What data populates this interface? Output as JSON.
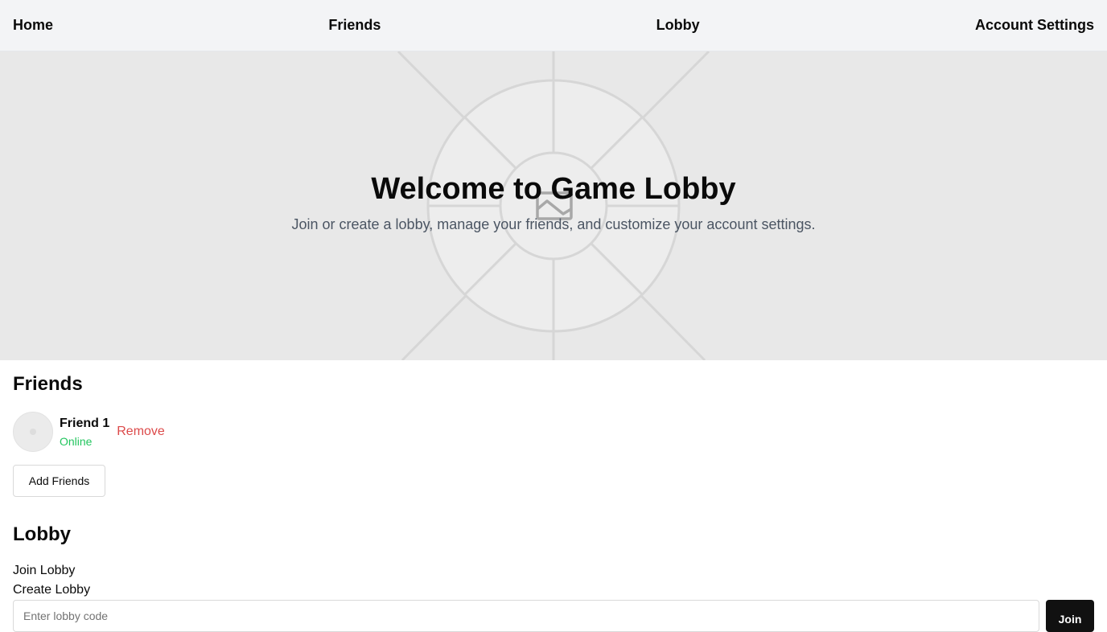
{
  "nav": {
    "home": "Home",
    "friends": "Friends",
    "lobby": "Lobby",
    "account_settings": "Account Settings"
  },
  "hero": {
    "title": "Welcome to Game Lobby",
    "subtitle": "Join or create a lobby, manage your friends, and customize your account settings.",
    "image_icon": "image-placeholder-icon"
  },
  "friends": {
    "heading": "Friends",
    "items": [
      {
        "name": "Friend 1",
        "status": "Online",
        "remove_label": "Remove"
      }
    ],
    "add_label": "Add Friends"
  },
  "lobby": {
    "heading": "Lobby",
    "join_label": "Join Lobby",
    "create_label": "Create Lobby",
    "code_placeholder": "Enter lobby code",
    "code_value": "",
    "join_button": "Join"
  },
  "colors": {
    "nav_bg": "#f3f4f6",
    "hero_bg": "#e8e8e8",
    "online": "#22c55e",
    "remove": "#dc4a4a",
    "primary_button": "#111111"
  }
}
